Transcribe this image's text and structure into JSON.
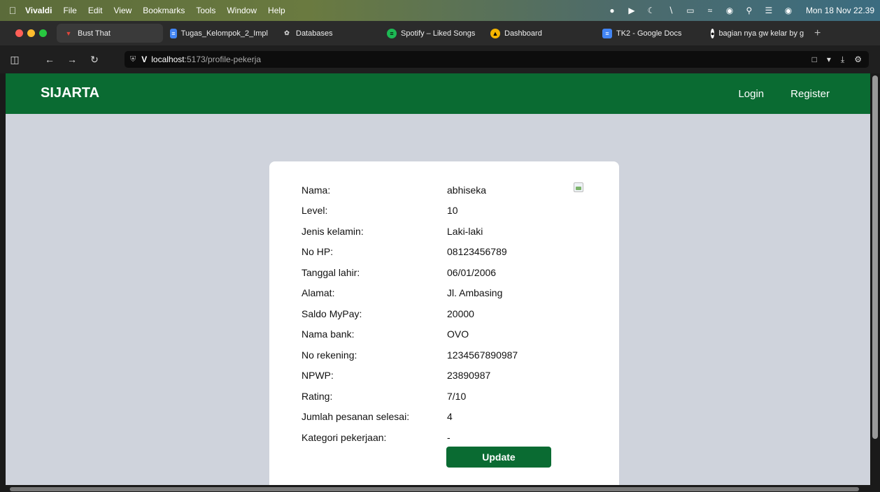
{
  "menubar": {
    "app": "Vivaldi",
    "items": [
      "File",
      "Edit",
      "View",
      "Bookmarks",
      "Tools",
      "Window",
      "Help"
    ],
    "clock": "Mon 18 Nov 22.39"
  },
  "tabs": [
    {
      "label": "Bust That",
      "icon": "vivaldi-icon",
      "color": "#e0463b"
    },
    {
      "label": "Tugas_Kelompok_2_Impl",
      "icon": "docs-icon",
      "color": "#4285f4"
    },
    {
      "label": "Databases",
      "icon": "openai-icon",
      "color": "#cccccc"
    },
    {
      "label": "Spotify – Liked Songs",
      "icon": "spotify-icon",
      "color": "#1db954"
    },
    {
      "label": "Dashboard",
      "icon": "dashboard-icon",
      "color": "#f4b400"
    },
    {
      "label": "TK2 - Google Docs",
      "icon": "docs-icon",
      "color": "#4285f4"
    },
    {
      "label": "bagian nya gw kelar by g",
      "icon": "github-icon",
      "color": "#ffffff"
    }
  ],
  "address": {
    "host": "localhost",
    "path": ":5173/profile-pekerja"
  },
  "site": {
    "brand": "SIJARTA",
    "login": "Login",
    "register": "Register"
  },
  "profile": {
    "rows": [
      {
        "label": "Nama:",
        "value": "abhiseka"
      },
      {
        "label": "Level:",
        "value": "10"
      },
      {
        "label": "Jenis kelamin:",
        "value": "Laki-laki"
      },
      {
        "label": "No HP:",
        "value": "08123456789"
      },
      {
        "label": "Tanggal lahir:",
        "value": "06/01/2006"
      },
      {
        "label": "Alamat:",
        "value": "Jl. Ambasing"
      },
      {
        "label": "Saldo MyPay:",
        "value": "20000"
      },
      {
        "label": "Nama bank:",
        "value": "OVO"
      },
      {
        "label": "No rekening:",
        "value": "1234567890987"
      },
      {
        "label": "NPWP:",
        "value": "23890987"
      },
      {
        "label": "Rating:",
        "value": "7/10"
      },
      {
        "label": "Jumlah pesanan selesai:",
        "value": "4"
      },
      {
        "label": "Kategori pekerjaan:",
        "value": "-"
      }
    ],
    "update_label": "Update"
  },
  "colors": {
    "brand_green": "#0a6b32",
    "page_bg": "#cfd3dc"
  }
}
